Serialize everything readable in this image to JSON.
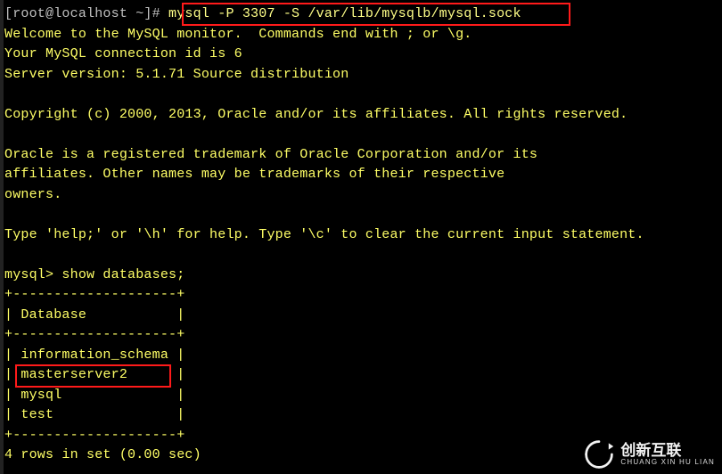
{
  "prompt_line": {
    "prompt": "[root@localhost ~]#",
    "command": "mysql -P 3307 -S /var/lib/mysqlb/mysql.sock"
  },
  "welcome_lines": [
    "Welcome to the MySQL monitor.  Commands end with ; or \\g.",
    "Your MySQL connection id is 6",
    "Server version: 5.1.71 Source distribution",
    "",
    "Copyright (c) 2000, 2013, Oracle and/or its affiliates. All rights reserved.",
    "",
    "Oracle is a registered trademark of Oracle Corporation and/or its",
    "affiliates. Other names may be trademarks of their respective",
    "owners.",
    "",
    "Type 'help;' or '\\h' for help. Type '\\c' to clear the current input statement.",
    ""
  ],
  "mysql_prompt": "mysql>",
  "mysql_command": "show databases;",
  "table": {
    "border_top": "+--------------------+",
    "header_row": "| Database           |",
    "border_mid": "+--------------------+",
    "rows": [
      "| information_schema |",
      "| masterserver2      |",
      "| mysql              |",
      "| test               |"
    ],
    "border_bottom": "+--------------------+"
  },
  "result_line": "4 rows in set (0.00 sec)",
  "watermark": {
    "cn": "创新互联",
    "en": "CHUANG XIN HU LIAN"
  },
  "colors": {
    "bg": "#000000",
    "text_default": "#e5e5e5",
    "text_yellow": "#ffff66",
    "highlight_border": "#ff1a1a"
  }
}
